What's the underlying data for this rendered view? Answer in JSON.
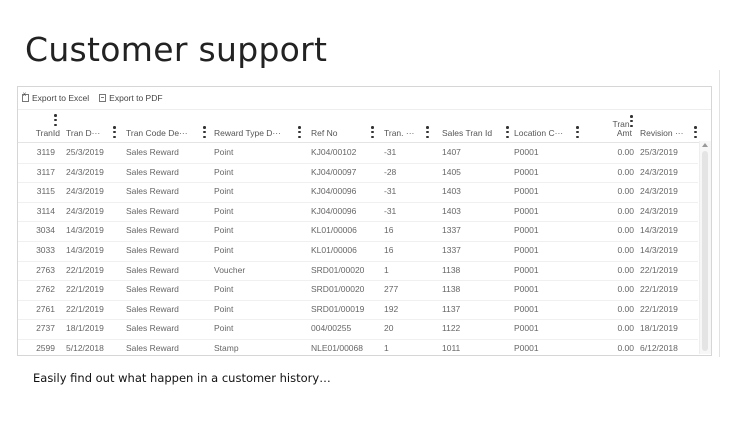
{
  "slide": {
    "title": "Customer support",
    "caption": "Easily find out what happen in a customer history…"
  },
  "toolbar": {
    "export_excel_label": "Export to Excel",
    "export_pdf_label": "Export to PDF"
  },
  "columns": [
    {
      "key": "tranid",
      "label": "TranId"
    },
    {
      "key": "tran_date",
      "label": "Tran D···"
    },
    {
      "key": "tran_code",
      "label": "Tran Code De···"
    },
    {
      "key": "reward_type",
      "label": "Reward Type D···"
    },
    {
      "key": "ref_no",
      "label": "Ref No"
    },
    {
      "key": "tran_qty",
      "label": "Tran. ···"
    },
    {
      "key": "sales_tran_id",
      "label": "Sales Tran Id"
    },
    {
      "key": "location",
      "label": "Location C···"
    },
    {
      "key": "tran_amt",
      "label": "Tran. Amt"
    },
    {
      "key": "revision",
      "label": "Revision ···"
    }
  ],
  "rows": [
    {
      "tranid": "3119",
      "tran_date": "25/3/2019",
      "tran_code": "Sales Reward",
      "reward_type": "Point",
      "ref_no": "KJ04/00102",
      "tran_qty": "-31",
      "sales_tran_id": "1407",
      "location": "P0001",
      "tran_amt": "0.00",
      "revision": "25/3/2019"
    },
    {
      "tranid": "3117",
      "tran_date": "24/3/2019",
      "tran_code": "Sales Reward",
      "reward_type": "Point",
      "ref_no": "KJ04/00097",
      "tran_qty": "-28",
      "sales_tran_id": "1405",
      "location": "P0001",
      "tran_amt": "0.00",
      "revision": "24/3/2019"
    },
    {
      "tranid": "3115",
      "tran_date": "24/3/2019",
      "tran_code": "Sales Reward",
      "reward_type": "Point",
      "ref_no": "KJ04/00096",
      "tran_qty": "-31",
      "sales_tran_id": "1403",
      "location": "P0001",
      "tran_amt": "0.00",
      "revision": "24/3/2019"
    },
    {
      "tranid": "3114",
      "tran_date": "24/3/2019",
      "tran_code": "Sales Reward",
      "reward_type": "Point",
      "ref_no": "KJ04/00096",
      "tran_qty": "-31",
      "sales_tran_id": "1403",
      "location": "P0001",
      "tran_amt": "0.00",
      "revision": "24/3/2019"
    },
    {
      "tranid": "3034",
      "tran_date": "14/3/2019",
      "tran_code": "Sales Reward",
      "reward_type": "Point",
      "ref_no": "KL01/00006",
      "tran_qty": "16",
      "sales_tran_id": "1337",
      "location": "P0001",
      "tran_amt": "0.00",
      "revision": "14/3/2019"
    },
    {
      "tranid": "3033",
      "tran_date": "14/3/2019",
      "tran_code": "Sales Reward",
      "reward_type": "Point",
      "ref_no": "KL01/00006",
      "tran_qty": "16",
      "sales_tran_id": "1337",
      "location": "P0001",
      "tran_amt": "0.00",
      "revision": "14/3/2019"
    },
    {
      "tranid": "2763",
      "tran_date": "22/1/2019",
      "tran_code": "Sales Reward",
      "reward_type": "Voucher",
      "ref_no": "SRD01/00020",
      "tran_qty": "1",
      "sales_tran_id": "1138",
      "location": "P0001",
      "tran_amt": "0.00",
      "revision": "22/1/2019"
    },
    {
      "tranid": "2762",
      "tran_date": "22/1/2019",
      "tran_code": "Sales Reward",
      "reward_type": "Point",
      "ref_no": "SRD01/00020",
      "tran_qty": "277",
      "sales_tran_id": "1138",
      "location": "P0001",
      "tran_amt": "0.00",
      "revision": "22/1/2019"
    },
    {
      "tranid": "2761",
      "tran_date": "22/1/2019",
      "tran_code": "Sales Reward",
      "reward_type": "Point",
      "ref_no": "SRD01/00019",
      "tran_qty": "192",
      "sales_tran_id": "1137",
      "location": "P0001",
      "tran_amt": "0.00",
      "revision": "22/1/2019"
    },
    {
      "tranid": "2737",
      "tran_date": "18/1/2019",
      "tran_code": "Sales Reward",
      "reward_type": "Point",
      "ref_no": "004/00255",
      "tran_qty": "20",
      "sales_tran_id": "1122",
      "location": "P0001",
      "tran_amt": "0.00",
      "revision": "18/1/2019"
    },
    {
      "tranid": "2599",
      "tran_date": "5/12/2018",
      "tran_code": "Sales Reward",
      "reward_type": "Stamp",
      "ref_no": "NLE01/00068",
      "tran_qty": "1",
      "sales_tran_id": "1011",
      "location": "P0001",
      "tran_amt": "0.00",
      "revision": "6/12/2018"
    }
  ]
}
